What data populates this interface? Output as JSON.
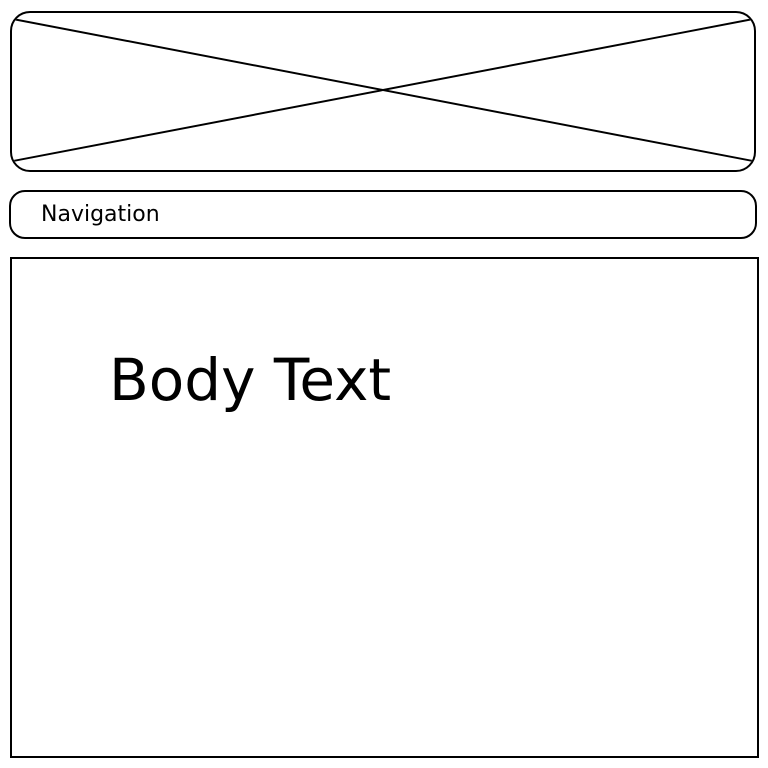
{
  "header": {
    "image_placeholder": "image-placeholder-icon"
  },
  "navigation": {
    "label": "Navigation"
  },
  "body": {
    "text": "Body Text"
  },
  "colors": {
    "stroke": "#000000",
    "background": "#ffffff"
  }
}
